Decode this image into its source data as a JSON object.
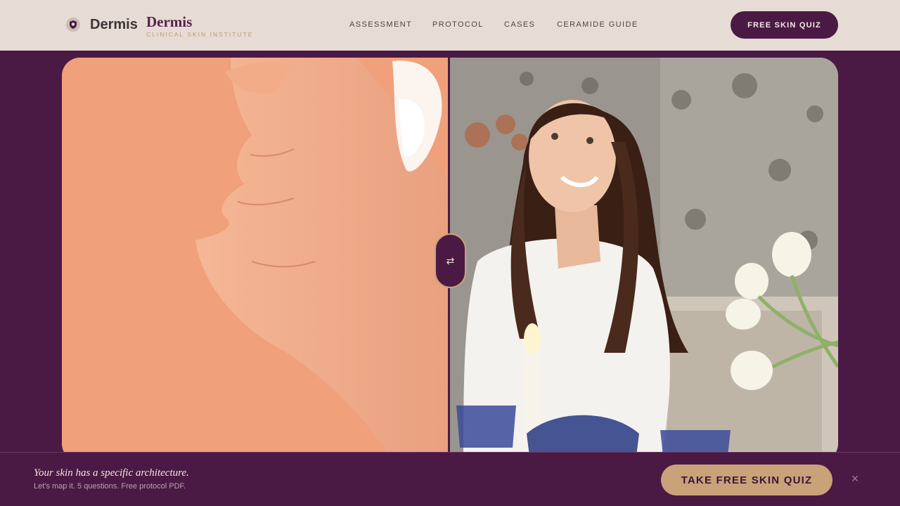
{
  "header": {
    "logo_icon": "shield-face-icon",
    "logo_word": "Dermis",
    "brand_name": "Dermis",
    "brand_tagline": "CLINICAL SKIN INSTITUTE",
    "nav": [
      {
        "label": "ASSESSMENT"
      },
      {
        "label": "PROTOCOL"
      },
      {
        "label": "CASES"
      },
      {
        "label": "CERAMIDE GUIDE"
      }
    ],
    "cta_label": "FREE SKIN QUIZ"
  },
  "compare": {
    "left_image": "hand-applying-cream-photo",
    "right_image": "smiling-woman-photo",
    "handle_icon": "compare-arrows-icon",
    "handle_glyph": "⇄"
  },
  "bottom_bar": {
    "title": "Your skin has a specific architecture.",
    "subtitle": "Let's map it. 5 questions. Free protocol PDF.",
    "cta_label": "TAKE FREE SKIN QUIZ",
    "close_glyph": "×"
  },
  "colors": {
    "brand_plum": "#4b1a44",
    "header_bg": "#e6dcd5",
    "accent_gold": "#c9a27a",
    "peach": "#f0a07a"
  }
}
